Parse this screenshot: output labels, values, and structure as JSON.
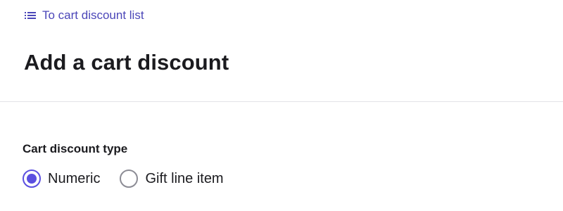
{
  "breadcrumb": {
    "back_label": "To cart discount list",
    "icon": "list-icon"
  },
  "page": {
    "title": "Add a cart discount"
  },
  "form": {
    "type_label": "Cart discount type",
    "options": [
      {
        "label": "Numeric",
        "selected": true
      },
      {
        "label": "Gift line item",
        "selected": false
      }
    ]
  },
  "colors": {
    "accent": "#5b4fe0",
    "link": "#4b46b8",
    "text": "#1b1b1f",
    "divider": "#e3e3e8"
  }
}
